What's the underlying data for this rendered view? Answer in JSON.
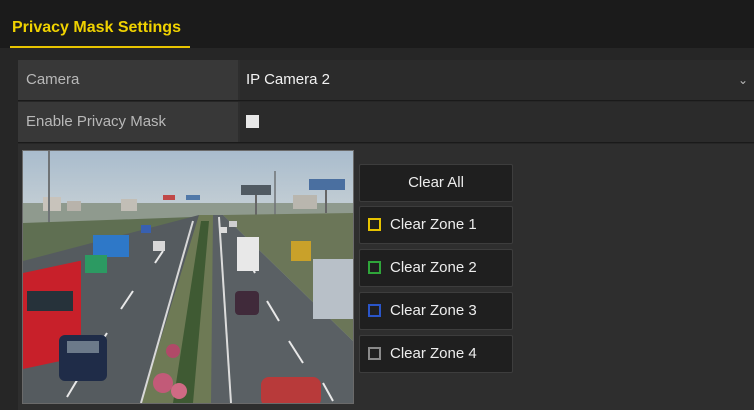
{
  "header": {
    "title": "Privacy Mask Settings"
  },
  "settings": {
    "camera": {
      "label": "Camera",
      "value": "IP Camera 2",
      "dropdown_icon": "chevron-down-icon"
    },
    "enable_privacy_mask": {
      "label": "Enable Privacy Mask",
      "checked": false
    }
  },
  "buttons": {
    "clear_all": "Clear All",
    "zones": [
      {
        "label": "Clear Zone 1",
        "color": "#e6c200"
      },
      {
        "label": "Clear Zone 2",
        "color": "#2fa53a"
      },
      {
        "label": "Clear Zone 3",
        "color": "#2a55c8"
      },
      {
        "label": "Clear Zone 4",
        "color": "#8a8a8a"
      }
    ]
  },
  "colors": {
    "accent": "#f0d200",
    "background": "#262626"
  }
}
